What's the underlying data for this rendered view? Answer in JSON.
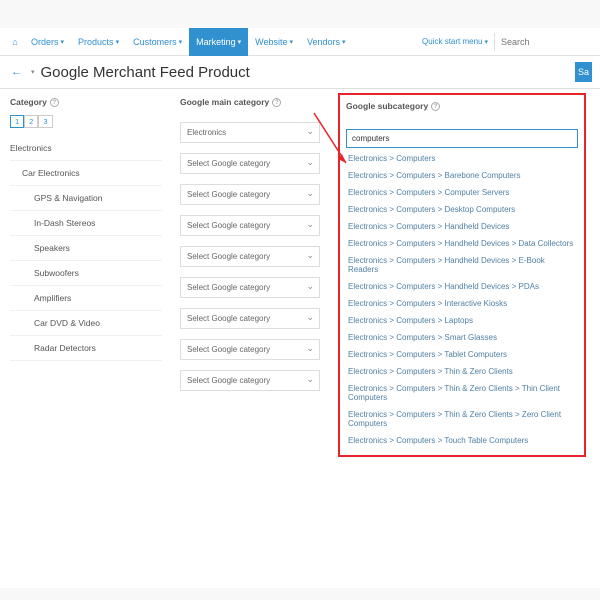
{
  "nav": {
    "home": "⌂",
    "quick": "Quick start menu",
    "search_ph": "Search",
    "items": [
      {
        "label": "Orders"
      },
      {
        "label": "Products"
      },
      {
        "label": "Customers"
      },
      {
        "label": "Marketing",
        "active": true
      },
      {
        "label": "Website"
      },
      {
        "label": "Vendors"
      }
    ]
  },
  "page_title": "Google Merchant Feed Product",
  "save": "Sa",
  "heads": {
    "cat": "Category",
    "main": "Google main category",
    "sub": "Google subcategory"
  },
  "pag": [
    "1",
    "2",
    "3"
  ],
  "cats": [
    {
      "label": "Electronics",
      "indent": 0,
      "main": "Electronics"
    },
    {
      "label": "Car Electronics",
      "indent": 1,
      "main": "Select Google category"
    },
    {
      "label": "GPS & Navigation",
      "indent": 2,
      "main": "Select Google category"
    },
    {
      "label": "In-Dash Stereos",
      "indent": 2,
      "main": "Select Google category"
    },
    {
      "label": "Speakers",
      "indent": 2,
      "main": "Select Google category"
    },
    {
      "label": "Subwoofers",
      "indent": 2,
      "main": "Select Google category"
    },
    {
      "label": "Amplifiers",
      "indent": 2,
      "main": "Select Google category"
    },
    {
      "label": "Car DVD & Video",
      "indent": 2,
      "main": "Select Google category"
    },
    {
      "label": "Radar Detectors",
      "indent": 2,
      "main": "Select Google category"
    }
  ],
  "sub_input": "computers",
  "subs": [
    "Electronics > Computers",
    "Electronics > Computers > Barebone Computers",
    "Electronics > Computers > Computer Servers",
    "Electronics > Computers > Desktop Computers",
    "Electronics > Computers > Handheld Devices",
    "Electronics > Computers > Handheld Devices > Data Collectors",
    "Electronics > Computers > Handheld Devices > E-Book Readers",
    "Electronics > Computers > Handheld Devices > PDAs",
    "Electronics > Computers > Interactive Kiosks",
    "Electronics > Computers > Laptops",
    "Electronics > Computers > Smart Glasses",
    "Electronics > Computers > Tablet Computers",
    "Electronics > Computers > Thin & Zero Clients",
    "Electronics > Computers > Thin & Zero Clients > Thin Client Computers",
    "Electronics > Computers > Thin & Zero Clients > Zero Client Computers",
    "Electronics > Computers > Touch Table Computers"
  ]
}
